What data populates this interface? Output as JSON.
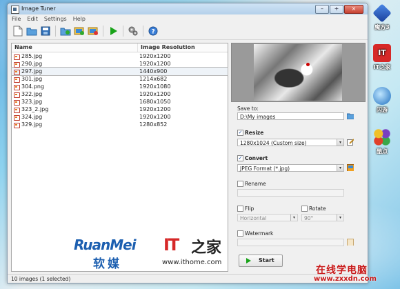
{
  "window": {
    "title": "Image Tuner",
    "btn_min": "–",
    "btn_max": "+",
    "btn_close": "×"
  },
  "menu": [
    "File",
    "Edit",
    "Settings",
    "Help"
  ],
  "toolbar": [
    "new-file-icon",
    "open-folder-icon",
    "save-icon",
    "add-folder-icon",
    "add-images-icon",
    "remove-images-icon",
    "start-icon",
    "settings-icon",
    "help-icon"
  ],
  "filelist": {
    "col_name": "Name",
    "col_res": "Image Resolution",
    "rows": [
      {
        "name": "285.jpg",
        "res": "1920x1200"
      },
      {
        "name": "290.jpg",
        "res": "1920x1200"
      },
      {
        "name": "297.jpg",
        "res": "1440x900",
        "selected": true
      },
      {
        "name": "301.jpg",
        "res": "1214x682"
      },
      {
        "name": "304.png",
        "res": "1920x1080"
      },
      {
        "name": "322.jpg",
        "res": "1920x1200"
      },
      {
        "name": "323.jpg",
        "res": "1680x1050"
      },
      {
        "name": "323_2.jpg",
        "res": "1920x1200"
      },
      {
        "name": "324.jpg",
        "res": "1920x1200"
      },
      {
        "name": "329.jpg",
        "res": "1280x852"
      }
    ]
  },
  "brand": {
    "ruanmei": "RuanMei",
    "ruanmei_cn": "软媒",
    "it": "IT",
    "home_cn": "之家",
    "ithome_url": "www.ithome.com"
  },
  "panel": {
    "save_to_label": "Save to:",
    "save_to_value": "D:\\My images",
    "resize_label": "Resize",
    "resize_checked": true,
    "resize_value": "1280x1024 (Custom size)",
    "convert_label": "Convert",
    "convert_checked": true,
    "convert_value": "JPEG Format (*.jpg)",
    "rename_label": "Rename",
    "rename_value": "",
    "flip_label": "Flip",
    "flip_value": "Horizontal",
    "rotate_label": "Rotate",
    "rotate_value": "90°",
    "watermark_label": "Watermark",
    "watermark_value": "",
    "start_label": "Start"
  },
  "status": "10 images (1 selected)",
  "desktop": {
    "icons": [
      {
        "label": "魔方3",
        "color": "#2b5fc0"
      },
      {
        "label": "IT之家",
        "color": "#d62828"
      },
      {
        "label": "闪游",
        "color": "#2a8bd8"
      },
      {
        "label": "酷点",
        "color": "#e8a020"
      }
    ],
    "watermark_cn": "在线学电脑",
    "watermark_url": "www.zxxdn.com"
  }
}
